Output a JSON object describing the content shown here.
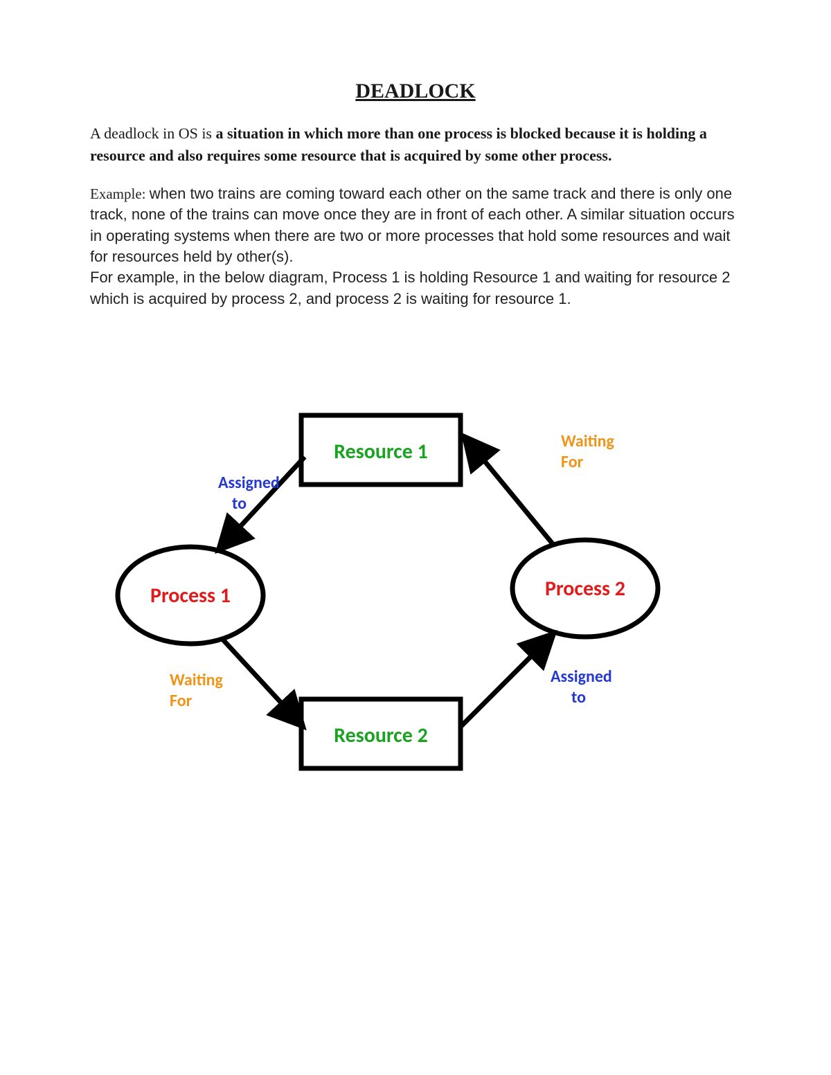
{
  "title": "DEADLOCK",
  "para1_intro": "A deadlock in OS is ",
  "para1_bold": "a situation in which more than one process is blocked because it is holding a resource and also requires some resource that is acquired by some other process.",
  "para2_example_label": "Example: ",
  "para2_body": "when two trains are coming toward each other on the same track and there is only one track, none of the trains can move once they are in front of each other. A similar situation occurs in operating systems when there are two or more processes that hold some resources and wait for resources held by other(s).",
  "para2_followup": " For example, in the below diagram, Process 1 is holding Resource 1 and waiting for resource 2 which is acquired by process 2, and process 2 is waiting for resource 1.",
  "diagram": {
    "nodes": {
      "resource1": "Resource 1",
      "resource2": "Resource 2",
      "process1": "Process 1",
      "process2": "Process 2"
    },
    "edges": {
      "assigned1_line1": "Assigned",
      "assigned1_line2": "to",
      "waiting1_line1": "Waiting",
      "waiting1_line2": "For",
      "assigned2_line1": "Assigned",
      "assigned2_line2": "to",
      "waiting2_line1": "Waiting",
      "waiting2_line2": "For"
    }
  }
}
